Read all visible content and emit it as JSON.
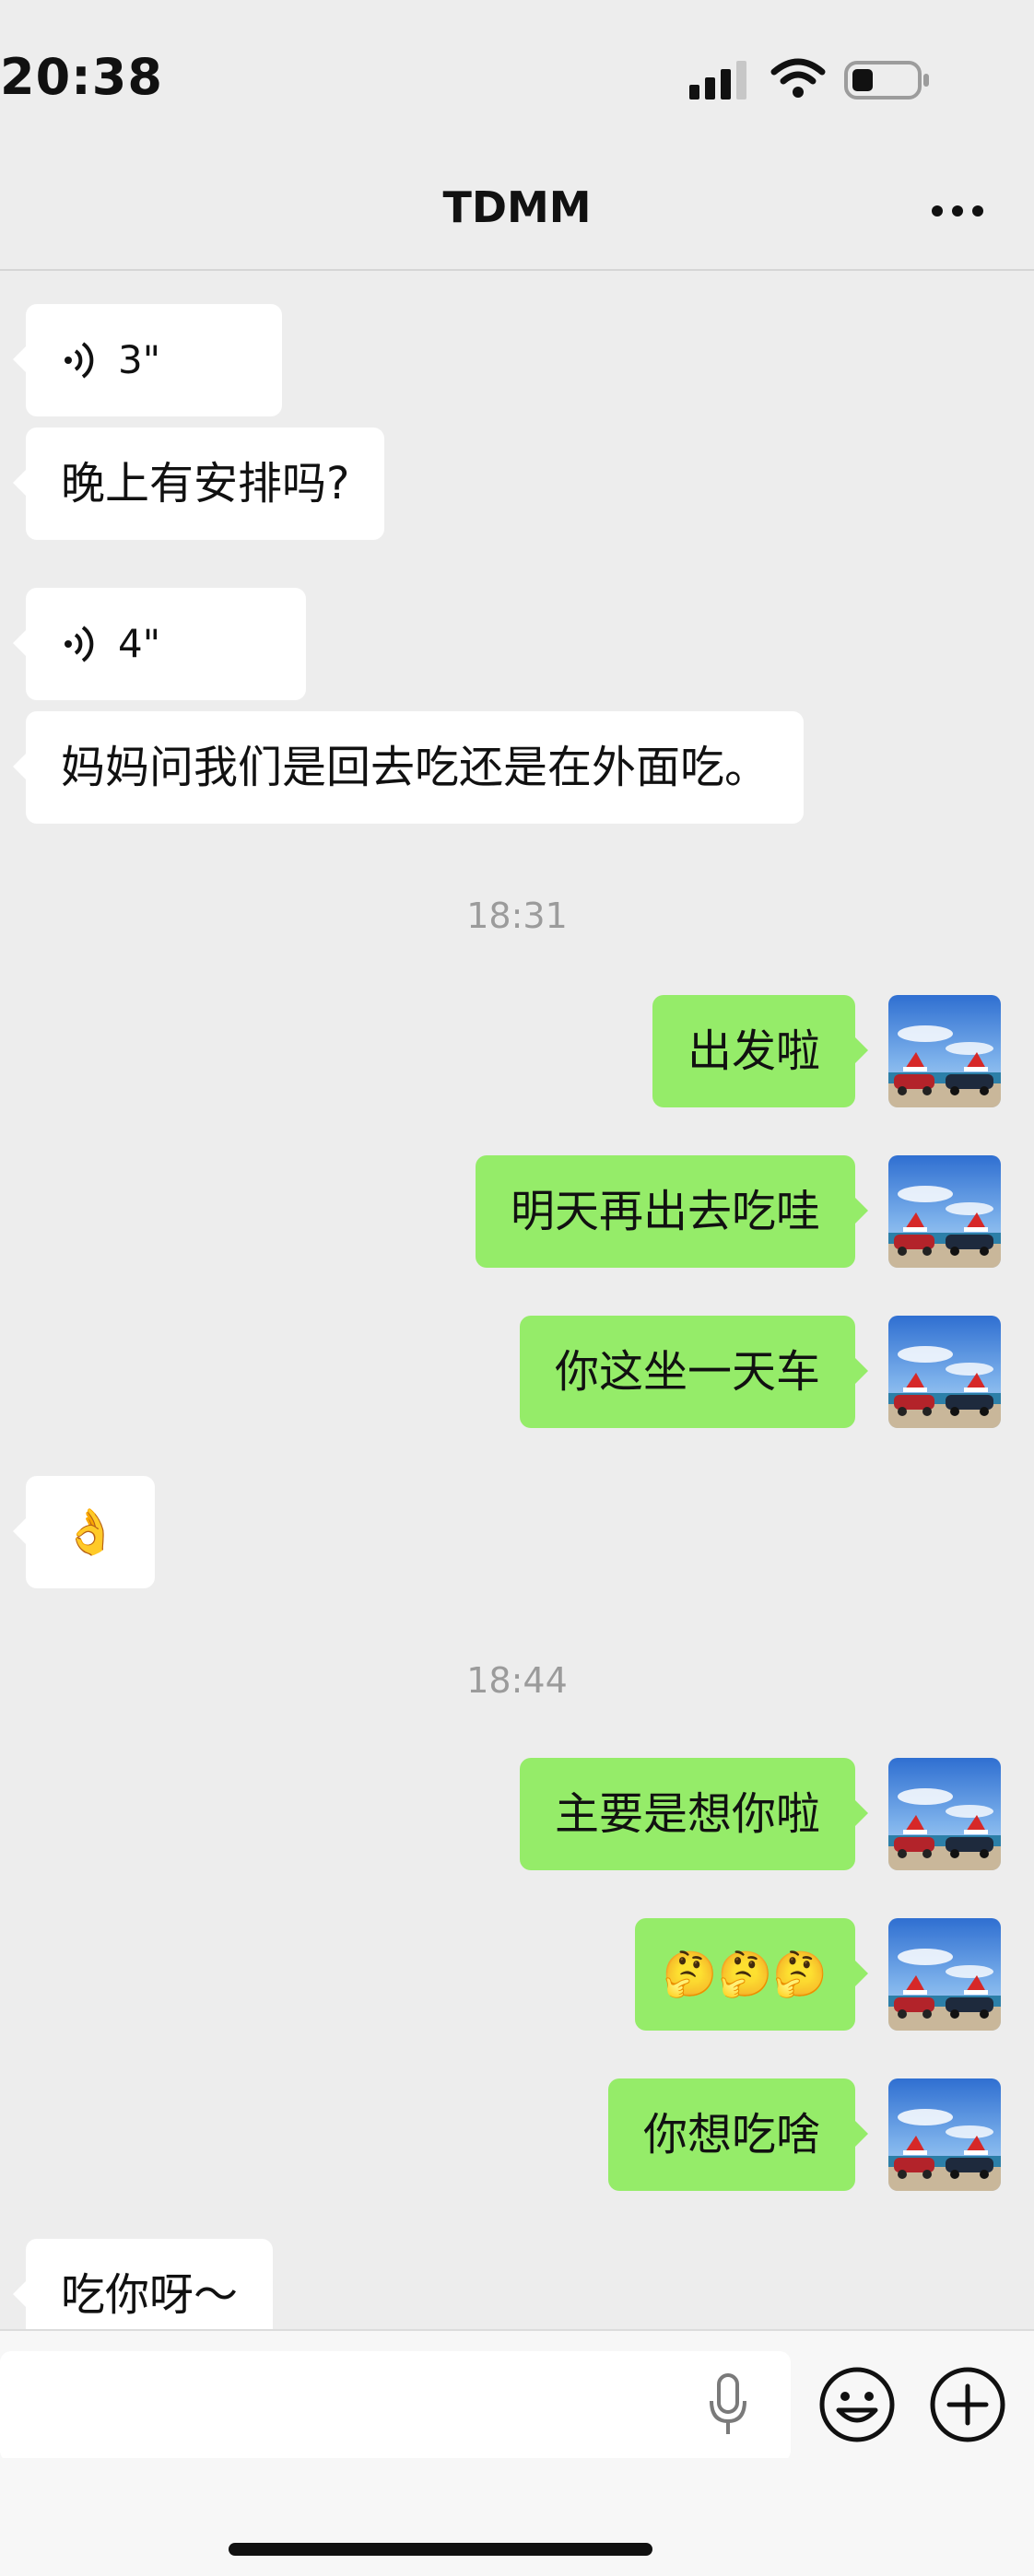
{
  "status_bar": {
    "time": "20:38"
  },
  "header": {
    "title": "TDMM"
  },
  "messages": [
    {
      "kind": "voice",
      "side": "in",
      "duration": "3\""
    },
    {
      "kind": "text",
      "side": "in",
      "text": "晚上有安排吗?"
    },
    {
      "kind": "voice",
      "side": "in",
      "duration": "4\""
    },
    {
      "kind": "text",
      "side": "in",
      "text": "妈妈问我们是回去吃还是在外面吃。"
    },
    {
      "kind": "time",
      "text": "18:31"
    },
    {
      "kind": "text",
      "side": "out",
      "text": "出发啦"
    },
    {
      "kind": "text",
      "side": "out",
      "text": "明天再出去吃哇"
    },
    {
      "kind": "text",
      "side": "out",
      "text": "你这坐一天车"
    },
    {
      "kind": "emoji",
      "side": "in",
      "text": "👌"
    },
    {
      "kind": "time",
      "text": "18:44"
    },
    {
      "kind": "text",
      "side": "out",
      "text": "主要是想你啦"
    },
    {
      "kind": "emoji",
      "side": "out",
      "text": "🤔🤔🤔"
    },
    {
      "kind": "text",
      "side": "out",
      "text": "你想吃啥"
    },
    {
      "kind": "text",
      "side": "in",
      "text": "吃你呀～"
    }
  ],
  "icons": {
    "voice": "voice-wave-icon",
    "avatar": "beach-cars-avatar",
    "mic": "microphone-icon",
    "emoji": "smiley-icon",
    "plus": "plus-circle-icon",
    "more": "more-dots-icon"
  },
  "colors": {
    "outgoing_bubble": "#95ec69",
    "incoming_bubble": "#ffffff",
    "background": "#ededed"
  }
}
